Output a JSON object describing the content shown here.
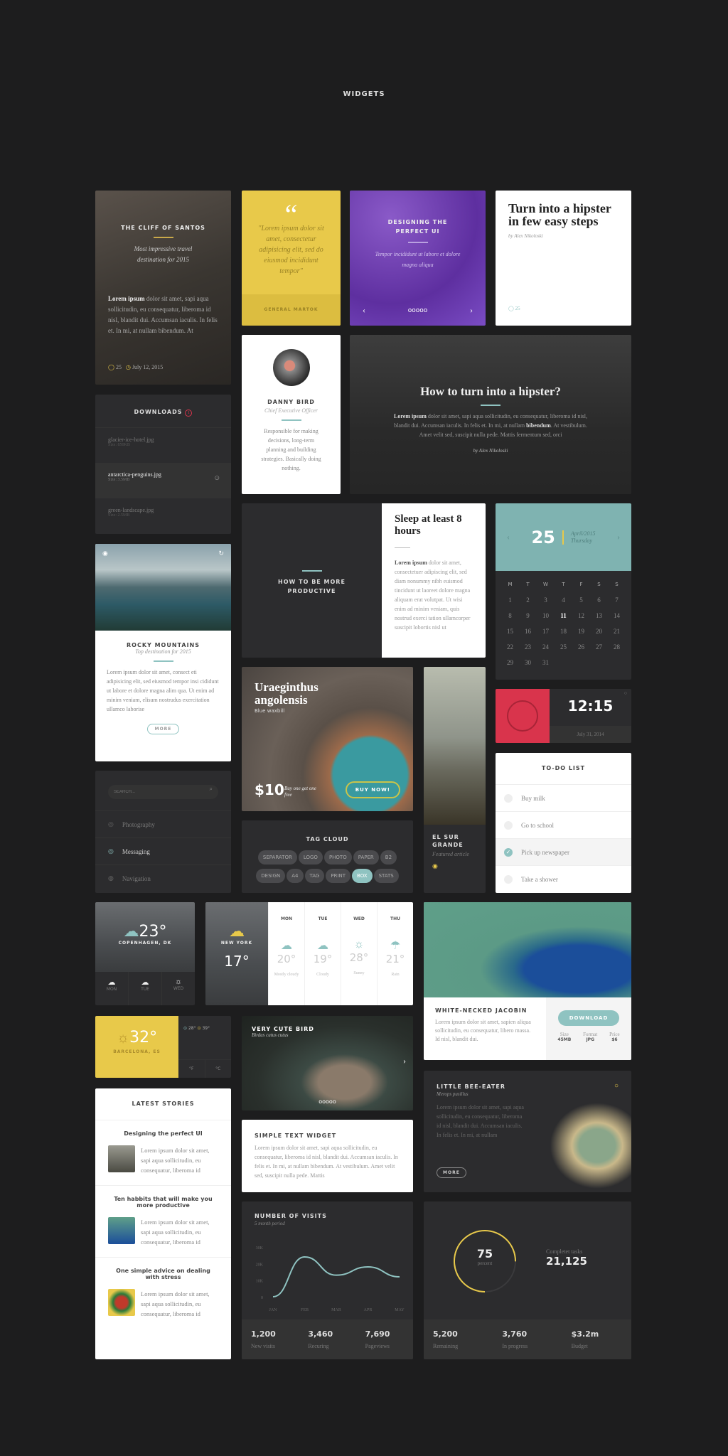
{
  "page_title": "WIDGETS",
  "cliff": {
    "title": "THE CLIFF OF SANTOS",
    "subtitle": "Most impressive travel destination for 2015",
    "body_bold": "Lorem ipsum",
    "body": " dolor sit amet, sapi aqua sollicitudin, eu consequatur, liberoma id nisl, blandit dui. Accumsan iaculis. In felis et. In mi, at nullam bibendum. At",
    "comments": "25",
    "date": "July 12, 2015"
  },
  "quote": {
    "mark": "“",
    "text": "\"Lorem ipsum dolor sit amet, consectetur adipisicing elit, sed do eiusmod incididunt tempor\"",
    "author": "GENERAL MARTOK"
  },
  "slider": {
    "title": "DESIGNING THE PERFECT UI",
    "text": "Tempor incididunt ut labore et dolore magna aliqua",
    "prev": "‹",
    "next": "›",
    "dots": "ooooo"
  },
  "article": {
    "title": "Turn into a hipster in few easy steps",
    "author": "by Alex Nikoloski",
    "comments": "25"
  },
  "profile": {
    "name": "DANNY BIRD",
    "role": "Chief Executive Officer",
    "bio": "Responsible for making decisions, long-term planning and building strategies. Basically doing nothing."
  },
  "hero": {
    "title": "How to turn into a hipster?",
    "body_bold": "Lorem ipsum",
    "body": " dolor sit amet, sapi aqua sollicitudin, eu consequatur, liberoma id nisl, blandit dui. Accumsan iaculis. In felis et. In mi, at nullam ",
    "body_bold2": "bibendum",
    "body_end": ". At vestibulum. Amet velit sed, suscipit nulla pede. Mattis fermentum sed, orci",
    "author": "by Alex Nikoloski"
  },
  "downloads": {
    "title": "DOWNLOADS",
    "badge": "1",
    "files": [
      {
        "name": "glacier-ice-hotel.jpg",
        "size": "Size: 850KB"
      },
      {
        "name": "antarctica-penguins.jpg",
        "size": "Size: 3.5MB"
      },
      {
        "name": "green-landscape.jpg",
        "size": "Size: 2.5MB"
      }
    ]
  },
  "rocky": {
    "title": "ROCKY MOUNTAINS",
    "subtitle": "Top destination for 2015",
    "body": "Lorem ipsum dolor sit amet, consect eti adipisicing elit, sed eiusmod tempor insi cididunt ut labore et dolore magna alim qua. Ut enim ad minim veniam, elisum nostrudus exercitation ullamco laborise",
    "more": "MORE"
  },
  "productive": {
    "title": "HOW TO BE MORE PRODUCTIVE",
    "side_title": "Sleep at least 8 hours",
    "body_bold": "Lorem ipsum",
    "body": " dolor sit amet, consectetuer adipiscing elit, sed diam nonummy nibh euismod tincidunt ut laoreet dolore magna aliquam erat volutpat. Ut wisi enim ad minim veniam, quis nostrud exerci tation ullamcorper suscipit lobortis nisl ut"
  },
  "calendar": {
    "day": "25",
    "month": "April/2015",
    "weekday": "Thursday",
    "prev": "‹",
    "next": "›",
    "headers": [
      "M",
      "T",
      "W",
      "T",
      "F",
      "S",
      "S"
    ],
    "today": 11,
    "days_in_month": 31
  },
  "clock": {
    "time": "12:15",
    "date": "July 31, 2014"
  },
  "waxbill": {
    "title": "Uraeginthus angolensis",
    "subtitle": "Blue waxbill",
    "price": "$10",
    "offer": "Buy one get one free",
    "button": "BUY NOW!"
  },
  "elsur": {
    "title": "EL SUR GRANDE",
    "subtitle": "Featured article"
  },
  "todo": {
    "title": "TO-DO LIST",
    "items": [
      {
        "label": "Buy milk",
        "done": false
      },
      {
        "label": "Go to school",
        "done": false
      },
      {
        "label": "Pick up newspaper",
        "done": true
      },
      {
        "label": "Take a shower",
        "done": false
      }
    ]
  },
  "menu": {
    "search_placeholder": "SEARCH...",
    "items": [
      "Photography",
      "Messaging",
      "Navigation"
    ],
    "active": "Messaging"
  },
  "tags": {
    "title": "TAG CLOUD",
    "items": [
      "SEPARATOR",
      "LOGO",
      "PHOTO",
      "PAPER",
      "B2",
      "DESIGN",
      "A4",
      "TAG",
      "PRINT",
      "BOX",
      "STATS"
    ],
    "active": "BOX"
  },
  "weather_cph": {
    "temp": "23°",
    "city": "COPENHAGEN, DK",
    "days": [
      "MON",
      "TUE",
      "WED"
    ]
  },
  "weather_ny": {
    "city": "NEW YORK",
    "temp": "17°",
    "forecast": [
      {
        "day": "MON",
        "temp": "20°",
        "cond": "Mostly cloudy"
      },
      {
        "day": "TUE",
        "temp": "19°",
        "cond": "Cloudy"
      },
      {
        "day": "WED",
        "temp": "28°",
        "cond": "Sunny"
      },
      {
        "day": "THU",
        "temp": "21°",
        "cond": "Rain"
      }
    ]
  },
  "jacobin": {
    "title": "WHITE-NECKED JACOBIN",
    "body": "Lorem ipsum dolor sit amet, sapien aliqua sollicitudin, eu consequatur, libero massa. Id nisl, blandit dui.",
    "button": "DOWNLOAD",
    "meta": [
      {
        "label": "Size",
        "value": "45MB"
      },
      {
        "label": "Format",
        "value": "JPG"
      },
      {
        "label": "Price",
        "value": "$6"
      }
    ]
  },
  "barcelona": {
    "temp": "32°",
    "city": "BARCELONA, ES",
    "low": "28°",
    "high": "39°",
    "unit_f": "°F",
    "unit_c": "°C"
  },
  "cutebird": {
    "title": "VERY CUTE BIRD",
    "subtitle": "Birdus cutus cutus",
    "dots": "ooooo",
    "next": "›"
  },
  "simple": {
    "title": "SIMPLE TEXT WIDGET",
    "body": "Lorem ipsum dolor sit amet, sapi aqua sollicitudin, eu consequatur, liberoma id nisl, blandit dui. Accumsan iaculis. In felis et. In mi, at nullam bibendum. At vestibulum. Amet velit sed, suscipit nulla pede. Mattis"
  },
  "beeeater": {
    "title": "LITTLE BEE-EATER",
    "subtitle": "Merops pusillus",
    "body": "Lorem ipsum dolor sit amet, sapi aqua sollicitudin, eu consequatur, liberoma id nisl, blandit dui. Accumsan iaculis. In felis et. In mi, at nullam",
    "more": "MORE"
  },
  "stories": {
    "title": "LATEST STORIES",
    "items": [
      {
        "title": "Designing the perfect UI",
        "body": "Lorem ipsum dolor sit amet, sapi aqua sollicitudin, eu consequatur, liberoma id"
      },
      {
        "title": "Ten habbits that will make you more productive",
        "body": "Lorem ipsum dolor sit amet, sapi aqua sollicitudin, eu consequatur, liberoma id"
      },
      {
        "title": "One simple advice on dealing with stress",
        "body": "Lorem ipsum dolor sit amet, sapi aqua sollicitudin, eu consequatur, liberoma id"
      }
    ]
  },
  "visits": {
    "title": "NUMBER OF VISITS",
    "subtitle": "5 month period",
    "stats": [
      {
        "value": "1,200",
        "label": "New visits"
      },
      {
        "value": "3,460",
        "label": "Recuring"
      },
      {
        "value": "7,690",
        "label": "Pageviews"
      }
    ]
  },
  "chart_data": {
    "type": "line",
    "categories": [
      "JAN",
      "FEB",
      "MAR",
      "APR",
      "MAY"
    ],
    "values": [
      0,
      24,
      13,
      18,
      12
    ],
    "yticks": [
      "0",
      "10K",
      "20K",
      "30K"
    ],
    "ylim": [
      0,
      30
    ],
    "grid": false,
    "color": "#8fc3c1"
  },
  "progress": {
    "value": 75,
    "unit": "percent",
    "label": "Completet tasks",
    "total": "21,125",
    "stats": [
      {
        "value": "5,200",
        "label": "Remaining"
      },
      {
        "value": "3,760",
        "label": "In progress"
      },
      {
        "value": "$3.2m",
        "label": "Budget"
      }
    ]
  },
  "colors": {
    "bg": "#1d1d1e",
    "card": "#2c2c2e",
    "teal": "#8fc3c1",
    "yellow": "#e8c94a",
    "purple": "#6b3fb0",
    "red": "#d9344c"
  }
}
